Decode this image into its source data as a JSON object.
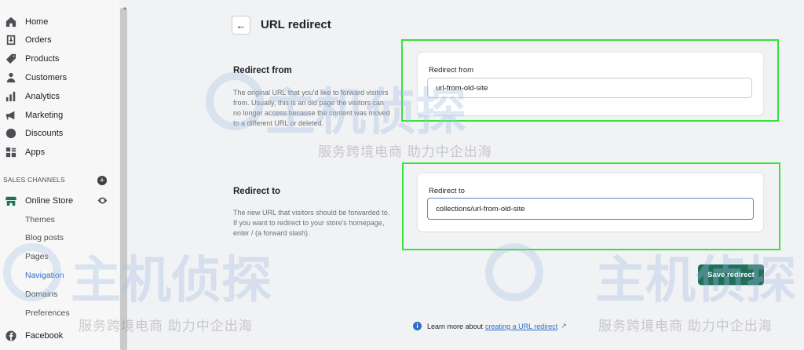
{
  "sidebar": {
    "items": [
      {
        "label": "Home",
        "icon": "home-icon"
      },
      {
        "label": "Orders",
        "icon": "orders-icon"
      },
      {
        "label": "Products",
        "icon": "tag-icon"
      },
      {
        "label": "Customers",
        "icon": "person-icon"
      },
      {
        "label": "Analytics",
        "icon": "bar-chart-icon"
      },
      {
        "label": "Marketing",
        "icon": "megaphone-icon"
      },
      {
        "label": "Discounts",
        "icon": "discount-icon"
      },
      {
        "label": "Apps",
        "icon": "apps-icon"
      }
    ],
    "section_label": "SALES CHANNELS",
    "online_store": "Online Store",
    "sub_items": [
      "Themes",
      "Blog posts",
      "Pages",
      "Navigation",
      "Domains",
      "Preferences"
    ],
    "facebook": "Facebook"
  },
  "header": {
    "back": "←",
    "title": "URL redirect"
  },
  "redirect_from": {
    "title": "Redirect from",
    "description": "The original URL that you'd like to forward visitors from. Usually, this is an old page the visitors can no longer access because the content was moved to a different URL or deleted.",
    "label": "Redirect from",
    "value": "url-from-old-site"
  },
  "redirect_to": {
    "title": "Redirect to",
    "description": "The new URL that visitors should be forwarded to. If you want to redirect to your store's homepage, enter / (a forward slash).",
    "label": "Redirect to",
    "value": "collections/url-from-old-site"
  },
  "save_button": "Save redirect",
  "learn_more": {
    "prefix": "Learn more about",
    "link": "creating a URL redirect"
  },
  "watermark": {
    "main": "主机侦探",
    "sub": "服务跨境电商 助力中企出海"
  },
  "colors": {
    "primary_button": "#1f6f59",
    "highlight": "#35e33a",
    "link": "#2c6ecb"
  }
}
